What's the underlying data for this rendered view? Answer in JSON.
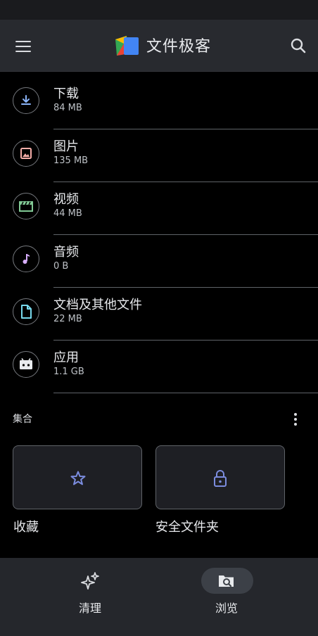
{
  "app": {
    "title": "文件极客"
  },
  "icons": {
    "menu": "menu-icon",
    "logo": "files-logo-icon",
    "search": "search-icon",
    "more": "more-vert-icon"
  },
  "categories": [
    {
      "name": "下载",
      "size": "84 MB",
      "icon": "download-icon",
      "color": "#8ab4f8"
    },
    {
      "name": "图片",
      "size": "135 MB",
      "icon": "image-icon",
      "color": "#f6aea9"
    },
    {
      "name": "视频",
      "size": "44 MB",
      "icon": "video-icon",
      "color": "#81c995"
    },
    {
      "name": "音频",
      "size": "0 B",
      "icon": "music-icon",
      "color": "#d7aefb"
    },
    {
      "name": "文档及其他文件",
      "size": "22 MB",
      "icon": "document-icon",
      "color": "#78d9ec"
    },
    {
      "name": "应用",
      "size": "1.1 GB",
      "icon": "android-icon",
      "color": "#e8eaed"
    }
  ],
  "collections": {
    "label": "集合",
    "items": [
      {
        "label": "收藏",
        "icon": "star-icon",
        "color": "#7b8cde"
      },
      {
        "label": "安全文件夹",
        "icon": "lock-icon",
        "color": "#7b8cde"
      }
    ]
  },
  "bottom_nav": [
    {
      "label": "清理",
      "icon": "sparkle-icon",
      "active": false
    },
    {
      "label": "浏览",
      "icon": "browse-icon",
      "active": true
    }
  ]
}
